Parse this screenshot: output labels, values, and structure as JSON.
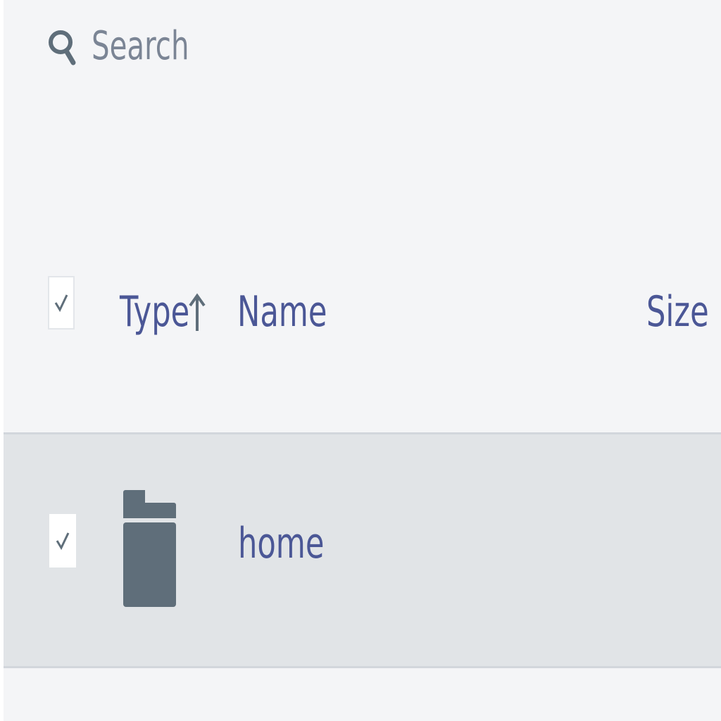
{
  "search": {
    "placeholder": "Search",
    "icon": "search-icon"
  },
  "table": {
    "columns": [
      {
        "label": "Type",
        "sort": "ascending"
      },
      {
        "label": "Name"
      },
      {
        "label": "Size"
      }
    ],
    "rows": [
      {
        "type_icon": "folder-icon",
        "name": "home",
        "size": "",
        "selected": true
      }
    ],
    "select_all": true
  },
  "colors": {
    "background": "#f4f5f7",
    "row_highlight": "#e1e4e7",
    "link_text": "#4b5796",
    "icon": "#5f6e7a",
    "muted_text": "#7b8595"
  }
}
